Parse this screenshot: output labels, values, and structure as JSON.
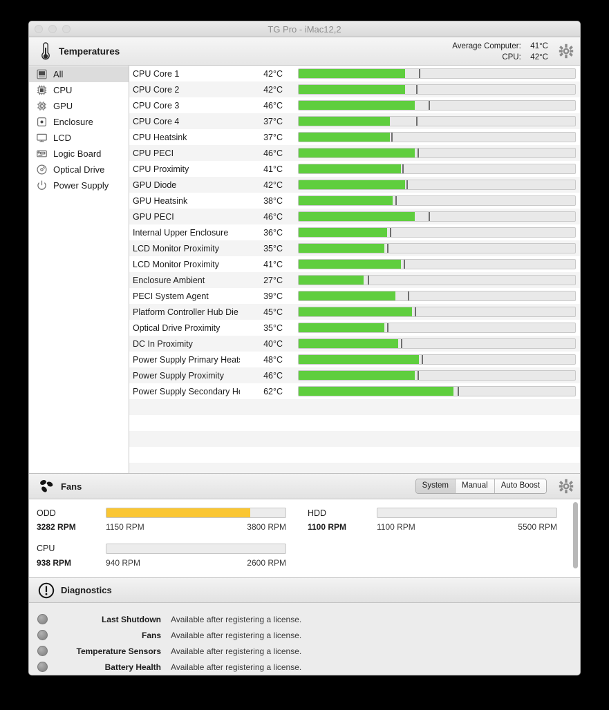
{
  "window": {
    "title": "TG Pro - iMac12,2",
    "traffic_lights": [
      "close",
      "minimize",
      "zoom"
    ]
  },
  "temperatures": {
    "header_title": "Temperatures",
    "header_icon": "thermometer-icon",
    "gear_icon": "gear-icon",
    "average_label": "Average Computer:",
    "average_value": "41°C",
    "cpu_label": "CPU:",
    "cpu_value": "42°C",
    "sidebar": [
      {
        "label": "All",
        "icon": "computer-icon",
        "selected": true
      },
      {
        "label": "CPU",
        "icon": "cpu-chip-icon",
        "selected": false
      },
      {
        "label": "GPU",
        "icon": "gpu-chip-icon",
        "selected": false
      },
      {
        "label": "Enclosure",
        "icon": "enclosure-icon",
        "selected": false
      },
      {
        "label": "LCD",
        "icon": "monitor-icon",
        "selected": false
      },
      {
        "label": "Logic Board",
        "icon": "logic-board-icon",
        "selected": false
      },
      {
        "label": "Optical Drive",
        "icon": "optical-drive-icon",
        "selected": false
      },
      {
        "label": "Power Supply",
        "icon": "power-icon",
        "selected": false
      }
    ],
    "bar_color": "#5fce3e",
    "sensors": [
      {
        "name": "CPU Core 1",
        "value": "42°C",
        "fill_pct": 38.5,
        "tick_pct": 43.5
      },
      {
        "name": "CPU Core 2",
        "value": "42°C",
        "fill_pct": 38.5,
        "tick_pct": 42.5
      },
      {
        "name": "CPU Core 3",
        "value": "46°C",
        "fill_pct": 42.0,
        "tick_pct": 47.0
      },
      {
        "name": "CPU Core 4",
        "value": "37°C",
        "fill_pct": 33.0,
        "tick_pct": 42.5
      },
      {
        "name": "CPU Heatsink",
        "value": "37°C",
        "fill_pct": 33.0,
        "tick_pct": 33.5
      },
      {
        "name": "CPU PECI",
        "value": "46°C",
        "fill_pct": 42.0,
        "tick_pct": 43.0
      },
      {
        "name": "CPU Proximity",
        "value": "41°C",
        "fill_pct": 37.0,
        "tick_pct": 37.5
      },
      {
        "name": "GPU Diode",
        "value": "42°C",
        "fill_pct": 38.5,
        "tick_pct": 39.0
      },
      {
        "name": "GPU Heatsink",
        "value": "38°C",
        "fill_pct": 34.0,
        "tick_pct": 35.0
      },
      {
        "name": "GPU PECI",
        "value": "46°C",
        "fill_pct": 42.0,
        "tick_pct": 47.0
      },
      {
        "name": "Internal Upper Enclosure",
        "value": "36°C",
        "fill_pct": 32.0,
        "tick_pct": 33.0
      },
      {
        "name": "LCD Monitor Proximity",
        "value": "35°C",
        "fill_pct": 31.0,
        "tick_pct": 32.0
      },
      {
        "name": "LCD Monitor Proximity",
        "value": "41°C",
        "fill_pct": 37.0,
        "tick_pct": 38.0
      },
      {
        "name": "Enclosure Ambient",
        "value": "27°C",
        "fill_pct": 23.5,
        "tick_pct": 25.0
      },
      {
        "name": "PECI System Agent",
        "value": "39°C",
        "fill_pct": 35.0,
        "tick_pct": 39.5
      },
      {
        "name": "Platform Controller Hub Die",
        "value": "45°C",
        "fill_pct": 41.0,
        "tick_pct": 42.0
      },
      {
        "name": "Optical Drive Proximity",
        "value": "35°C",
        "fill_pct": 31.0,
        "tick_pct": 32.0
      },
      {
        "name": "DC In Proximity",
        "value": "40°C",
        "fill_pct": 36.0,
        "tick_pct": 37.0
      },
      {
        "name": "Power Supply Primary Heatsink",
        "value": "48°C",
        "fill_pct": 43.5,
        "tick_pct": 44.5
      },
      {
        "name": "Power Supply Proximity",
        "value": "46°C",
        "fill_pct": 42.0,
        "tick_pct": 43.0
      },
      {
        "name": "Power Supply Secondary Heatsink",
        "value": "62°C",
        "fill_pct": 56.0,
        "tick_pct": 57.5
      }
    ]
  },
  "fans": {
    "header_title": "Fans",
    "header_icon": "fan-icon",
    "gear_icon": "gear-icon",
    "modes": [
      {
        "label": "System",
        "active": true
      },
      {
        "label": "Manual",
        "active": false
      },
      {
        "label": "Auto Boost",
        "active": false
      }
    ],
    "fill_color": "#fac633",
    "items": [
      {
        "label": "ODD",
        "current": "3282 RPM",
        "min": "1150 RPM",
        "max": "3800 RPM",
        "fill_pct": 80.5
      },
      {
        "label": "HDD",
        "current": "1100 RPM",
        "min": "1100 RPM",
        "max": "5500 RPM",
        "fill_pct": 0
      },
      {
        "label": "CPU",
        "current": "938 RPM",
        "min": "940 RPM",
        "max": "2600 RPM",
        "fill_pct": 0
      }
    ]
  },
  "diagnostics": {
    "header_title": "Diagnostics",
    "header_icon": "exclamation-circle-icon",
    "rows": [
      {
        "label": "Last Shutdown",
        "status": "Available after registering a license."
      },
      {
        "label": "Fans",
        "status": "Available after registering a license."
      },
      {
        "label": "Temperature Sensors",
        "status": "Available after registering a license."
      },
      {
        "label": "Battery Health",
        "status": "Available after registering a license."
      }
    ]
  }
}
